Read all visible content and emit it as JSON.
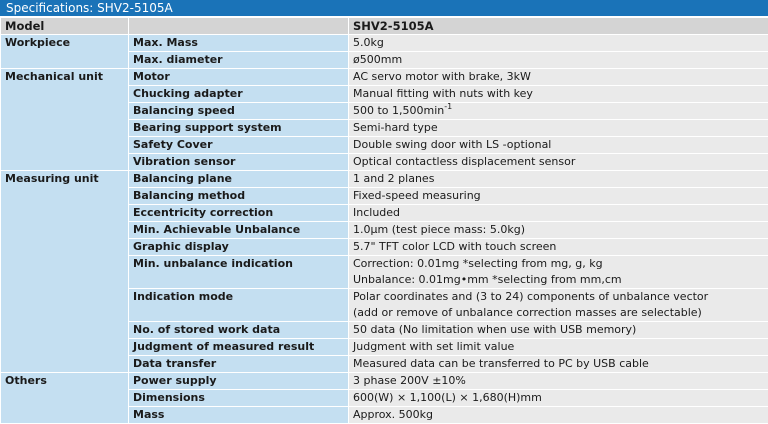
{
  "title": "Specifications: SHV2-5105A",
  "header": {
    "col1": "Model",
    "col2": "",
    "col3": "SHV2-5105A"
  },
  "categories": {
    "workpiece": "Workpiece",
    "mechanical": "Mechanical unit",
    "measuring": "Measuring unit",
    "others": "Others"
  },
  "rows": [
    {
      "item": "Max. Mass",
      "value": "5.0kg"
    },
    {
      "item": "Max. diameter",
      "value": "ø500mm"
    },
    {
      "item": "Motor",
      "value": "AC servo motor with brake, 3kW"
    },
    {
      "item": "Chucking adapter",
      "value": "Manual fitting with nuts with key"
    },
    {
      "item": "Balancing speed",
      "value": "500 to 1,500min",
      "value_sup": "-1"
    },
    {
      "item": "Bearing support system",
      "value": "Semi-hard type"
    },
    {
      "item": "Safety Cover",
      "value": "Double swing door with LS -optional"
    },
    {
      "item": "Vibration sensor",
      "value": "Optical contactless displacement sensor"
    },
    {
      "item": "Balancing plane",
      "value": "1 and 2 planes"
    },
    {
      "item": "Balancing method",
      "value": "Fixed-speed measuring"
    },
    {
      "item": "Eccentricity correction",
      "value": "Included"
    },
    {
      "item": "Min. Achievable Unbalance",
      "value": "1.0μm (test piece mass: 5.0kg)"
    },
    {
      "item": "Graphic display",
      "value": "5.7\" TFT color LCD with touch screen"
    },
    {
      "item": "Min. unbalance indication",
      "value": "Correction: 0.01mg *selecting from mg, g, kg",
      "value2": "Unbalance: 0.01mg•mm *selecting from mm,cm"
    },
    {
      "item": "Indication mode",
      "value": "Polar coordinates and (3 to 24) components of unbalance vector",
      "value2": "(add or remove of unbalance correction masses are selectable)"
    },
    {
      "item": "No. of stored work data",
      "value": "50 data (No limitation when use with USB memory)"
    },
    {
      "item": "Judgment of measured result",
      "value": "Judgment with set limit value"
    },
    {
      "item": "Data transfer",
      "value": "Measured data can be transferred to PC by USB cable"
    },
    {
      "item": "Power supply",
      "value": "3 phase 200V ±10%"
    },
    {
      "item": "Dimensions",
      "value": "600(W) × 1,100(L) × 1,680(H)mm"
    },
    {
      "item": "Mass",
      "value": "Approx. 500kg"
    }
  ]
}
